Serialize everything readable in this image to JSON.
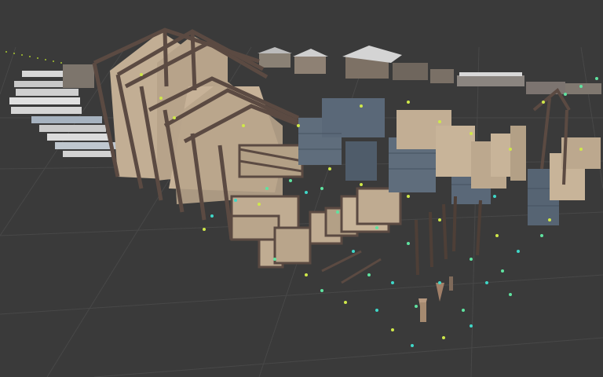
{
  "scene": {
    "background": "#3a3a3a",
    "grid_color": "#4a4a4a",
    "plank_color": "#5b4a42",
    "plank_dark": "#3e322d",
    "plaster_color": "#c8b499",
    "plaster_shade": "#9d8a72",
    "glass_color": "#5f6d7c",
    "glass_dark": "#465260",
    "roof_color": "#cfcfcf",
    "marker_colors": [
      "#cfe84a",
      "#5fe3a0",
      "#3fd7c8"
    ]
  }
}
